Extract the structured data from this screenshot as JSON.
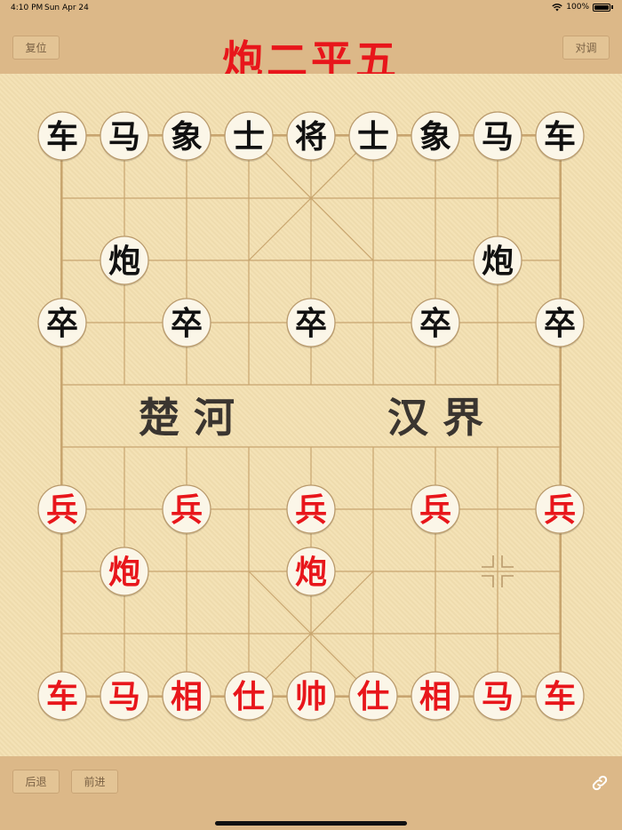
{
  "status_bar": {
    "time": "4:10 PM",
    "date": "Sun Apr 24",
    "battery": "100%"
  },
  "header": {
    "reset_label": "复位",
    "title": "炮二平五",
    "swap_label": "对调"
  },
  "board": {
    "river_left": "楚 河",
    "river_right": "汉 界",
    "colors": {
      "red": "#e8161b",
      "black": "#111111",
      "line": "#c8a56f",
      "piece_bg": "#fbf6e8",
      "piece_border": "#b99a6c"
    },
    "pieces": [
      {
        "col": 0,
        "row": 0,
        "label": "车",
        "side": "black"
      },
      {
        "col": 1,
        "row": 0,
        "label": "马",
        "side": "black"
      },
      {
        "col": 2,
        "row": 0,
        "label": "象",
        "side": "black"
      },
      {
        "col": 3,
        "row": 0,
        "label": "士",
        "side": "black"
      },
      {
        "col": 4,
        "row": 0,
        "label": "将",
        "side": "black"
      },
      {
        "col": 5,
        "row": 0,
        "label": "士",
        "side": "black"
      },
      {
        "col": 6,
        "row": 0,
        "label": "象",
        "side": "black"
      },
      {
        "col": 7,
        "row": 0,
        "label": "马",
        "side": "black"
      },
      {
        "col": 8,
        "row": 0,
        "label": "车",
        "side": "black"
      },
      {
        "col": 1,
        "row": 2,
        "label": "炮",
        "side": "black"
      },
      {
        "col": 7,
        "row": 2,
        "label": "炮",
        "side": "black"
      },
      {
        "col": 0,
        "row": 3,
        "label": "卒",
        "side": "black"
      },
      {
        "col": 2,
        "row": 3,
        "label": "卒",
        "side": "black"
      },
      {
        "col": 4,
        "row": 3,
        "label": "卒",
        "side": "black"
      },
      {
        "col": 6,
        "row": 3,
        "label": "卒",
        "side": "black"
      },
      {
        "col": 8,
        "row": 3,
        "label": "卒",
        "side": "black"
      },
      {
        "col": 0,
        "row": 6,
        "label": "兵",
        "side": "red"
      },
      {
        "col": 2,
        "row": 6,
        "label": "兵",
        "side": "red"
      },
      {
        "col": 4,
        "row": 6,
        "label": "兵",
        "side": "red"
      },
      {
        "col": 6,
        "row": 6,
        "label": "兵",
        "side": "red"
      },
      {
        "col": 8,
        "row": 6,
        "label": "兵",
        "side": "red"
      },
      {
        "col": 1,
        "row": 7,
        "label": "炮",
        "side": "red"
      },
      {
        "col": 4,
        "row": 7,
        "label": "炮",
        "side": "red"
      },
      {
        "col": 0,
        "row": 9,
        "label": "车",
        "side": "red"
      },
      {
        "col": 1,
        "row": 9,
        "label": "马",
        "side": "red"
      },
      {
        "col": 2,
        "row": 9,
        "label": "相",
        "side": "red"
      },
      {
        "col": 3,
        "row": 9,
        "label": "仕",
        "side": "red"
      },
      {
        "col": 4,
        "row": 9,
        "label": "帅",
        "side": "red"
      },
      {
        "col": 5,
        "row": 9,
        "label": "仕",
        "side": "red"
      },
      {
        "col": 6,
        "row": 9,
        "label": "相",
        "side": "red"
      },
      {
        "col": 7,
        "row": 9,
        "label": "马",
        "side": "red"
      },
      {
        "col": 8,
        "row": 9,
        "label": "车",
        "side": "red"
      }
    ],
    "last_move_from": {
      "col": 7,
      "row": 7
    }
  },
  "footer": {
    "back_label": "后退",
    "forward_label": "前进",
    "share_icon": "link-icon"
  }
}
